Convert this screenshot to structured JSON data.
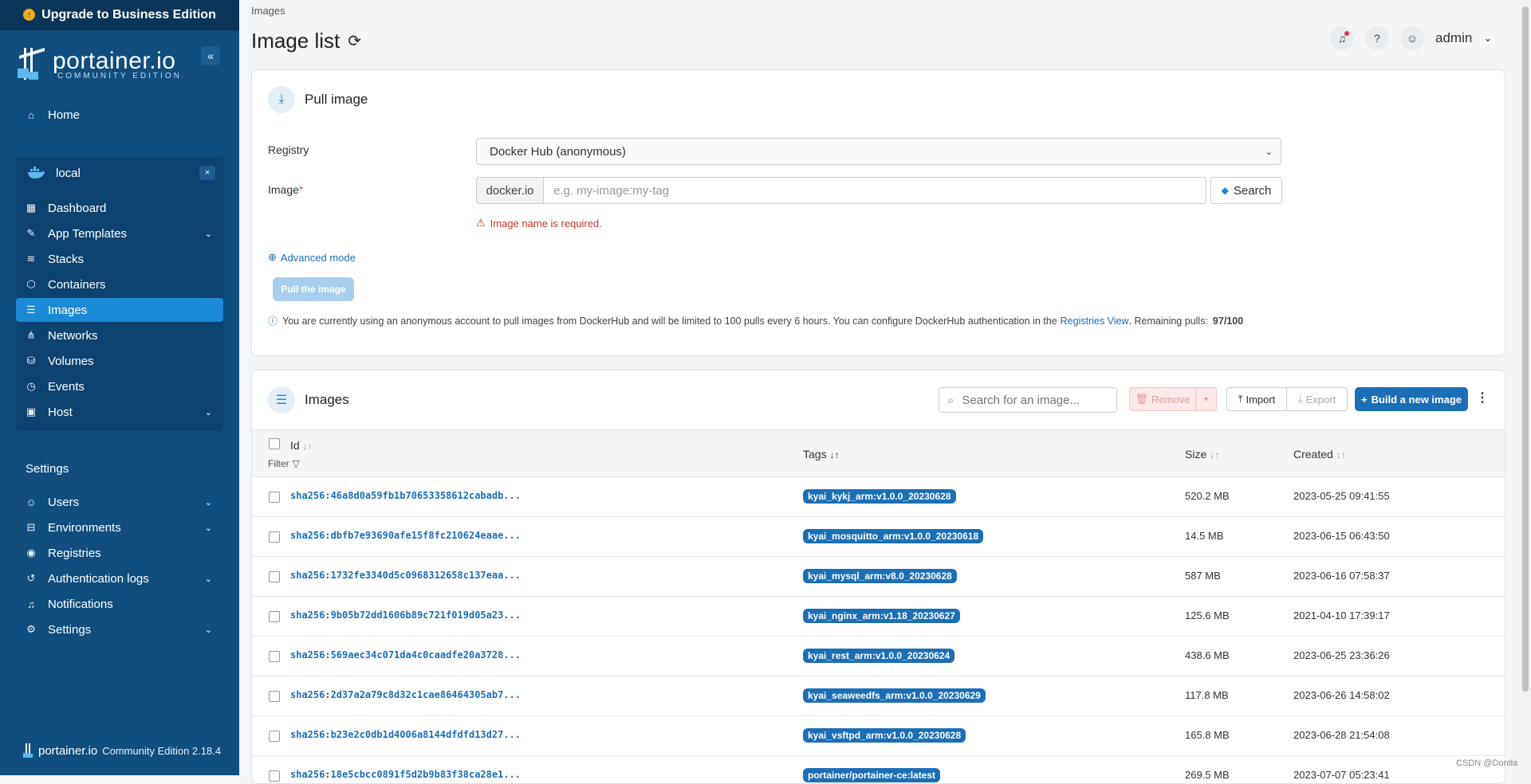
{
  "sidebar": {
    "upgrade_label": "Upgrade to Business Edition",
    "brand_main": "portainer.io",
    "brand_sub": "COMMUNITY EDITION",
    "collapse_glyph": "«",
    "home": "Home",
    "env_name": "local",
    "env_close": "×",
    "env_items": [
      {
        "label": "Dashboard",
        "icon": "dashboard-icon"
      },
      {
        "label": "App Templates",
        "icon": "edit-icon"
      },
      {
        "label": "Stacks",
        "icon": "layers-icon"
      },
      {
        "label": "Containers",
        "icon": "box-icon"
      },
      {
        "label": "Images",
        "icon": "list-icon"
      },
      {
        "label": "Networks",
        "icon": "share-icon"
      },
      {
        "label": "Volumes",
        "icon": "database-icon"
      },
      {
        "label": "Events",
        "icon": "clock-icon"
      },
      {
        "label": "Host",
        "icon": "host-icon"
      }
    ],
    "settings_heading": "Settings",
    "settings_items": [
      {
        "label": "Users"
      },
      {
        "label": "Environments"
      },
      {
        "label": "Registries"
      },
      {
        "label": "Authentication logs"
      },
      {
        "label": "Notifications"
      },
      {
        "label": "Settings"
      }
    ],
    "footer_brand": "portainer.io",
    "footer_version": "Community Edition 2.18.4"
  },
  "header": {
    "breadcrumb": "Images",
    "title": "Image list",
    "user": "admin"
  },
  "pull": {
    "title": "Pull image",
    "registry_label": "Registry",
    "registry_value": "Docker Hub (anonymous)",
    "image_label": "Image",
    "image_required": "*",
    "image_prefix": "docker.io",
    "image_placeholder": "e.g. my-image:my-tag",
    "search_label": "Search",
    "error": "Image name is required.",
    "advanced": "Advanced mode",
    "pull_button": "Pull the image",
    "info_text": "You are currently using an anonymous account to pull images from DockerHub and will be limited to 100 pulls every 6 hours. You can configure DockerHub authentication in the",
    "info_link": "Registries View",
    "info_remaining_label": ". Remaining pulls:",
    "info_remaining": "97/100"
  },
  "images": {
    "title": "Images",
    "search_placeholder": "Search for an image...",
    "remove": "Remove",
    "import": "Import",
    "export": "Export",
    "build": "Build a new image",
    "columns": {
      "id": "Id",
      "filter": "Filter",
      "tags": "Tags",
      "size": "Size",
      "created": "Created"
    },
    "rows": [
      {
        "id": "sha256:46a8d0a59fb1b70653358612cabadb...",
        "tag": "kyai_kykj_arm:v1.0.0_20230628",
        "size": "520.2 MB",
        "created": "2023-05-25 09:41:55"
      },
      {
        "id": "sha256:dbfb7e93690afe15f8fc210624eaae...",
        "tag": "kyai_mosquitto_arm:v1.0.0_20230618",
        "size": "14.5 MB",
        "created": "2023-06-15 06:43:50"
      },
      {
        "id": "sha256:1732fe3340d5c0968312658c137eaa...",
        "tag": "kyai_mysql_arm:v8.0_20230628",
        "size": "587 MB",
        "created": "2023-06-16 07:58:37"
      },
      {
        "id": "sha256:9b05b72dd1606b89c721f019d05a23...",
        "tag": "kyai_nginx_arm:v1.18_20230627",
        "size": "125.6 MB",
        "created": "2021-04-10 17:39:17"
      },
      {
        "id": "sha256:569aec34c071da4c0caadfe20a3728...",
        "tag": "kyai_rest_arm:v1.0.0_20230624",
        "size": "438.6 MB",
        "created": "2023-06-25 23:36:26"
      },
      {
        "id": "sha256:2d37a2a79c8d32c1cae86464305ab7...",
        "tag": "kyai_seaweedfs_arm:v1.0.0_20230629",
        "size": "117.8 MB",
        "created": "2023-06-26 14:58:02"
      },
      {
        "id": "sha256:b23e2c0db1d4006a8144dfdfd13d27...",
        "tag": "kyai_vsftpd_arm:v1.0.0_20230628",
        "size": "165.8 MB",
        "created": "2023-06-28 21:54:08"
      },
      {
        "id": "sha256:18e5cbcc0891f5d2b9b83f38ca28e1...",
        "tag": "portainer/portainer-ce:latest",
        "size": "269.5 MB",
        "created": "2023-07-07 05:23:41"
      }
    ]
  },
  "watermark": "CSDN @Dontla"
}
